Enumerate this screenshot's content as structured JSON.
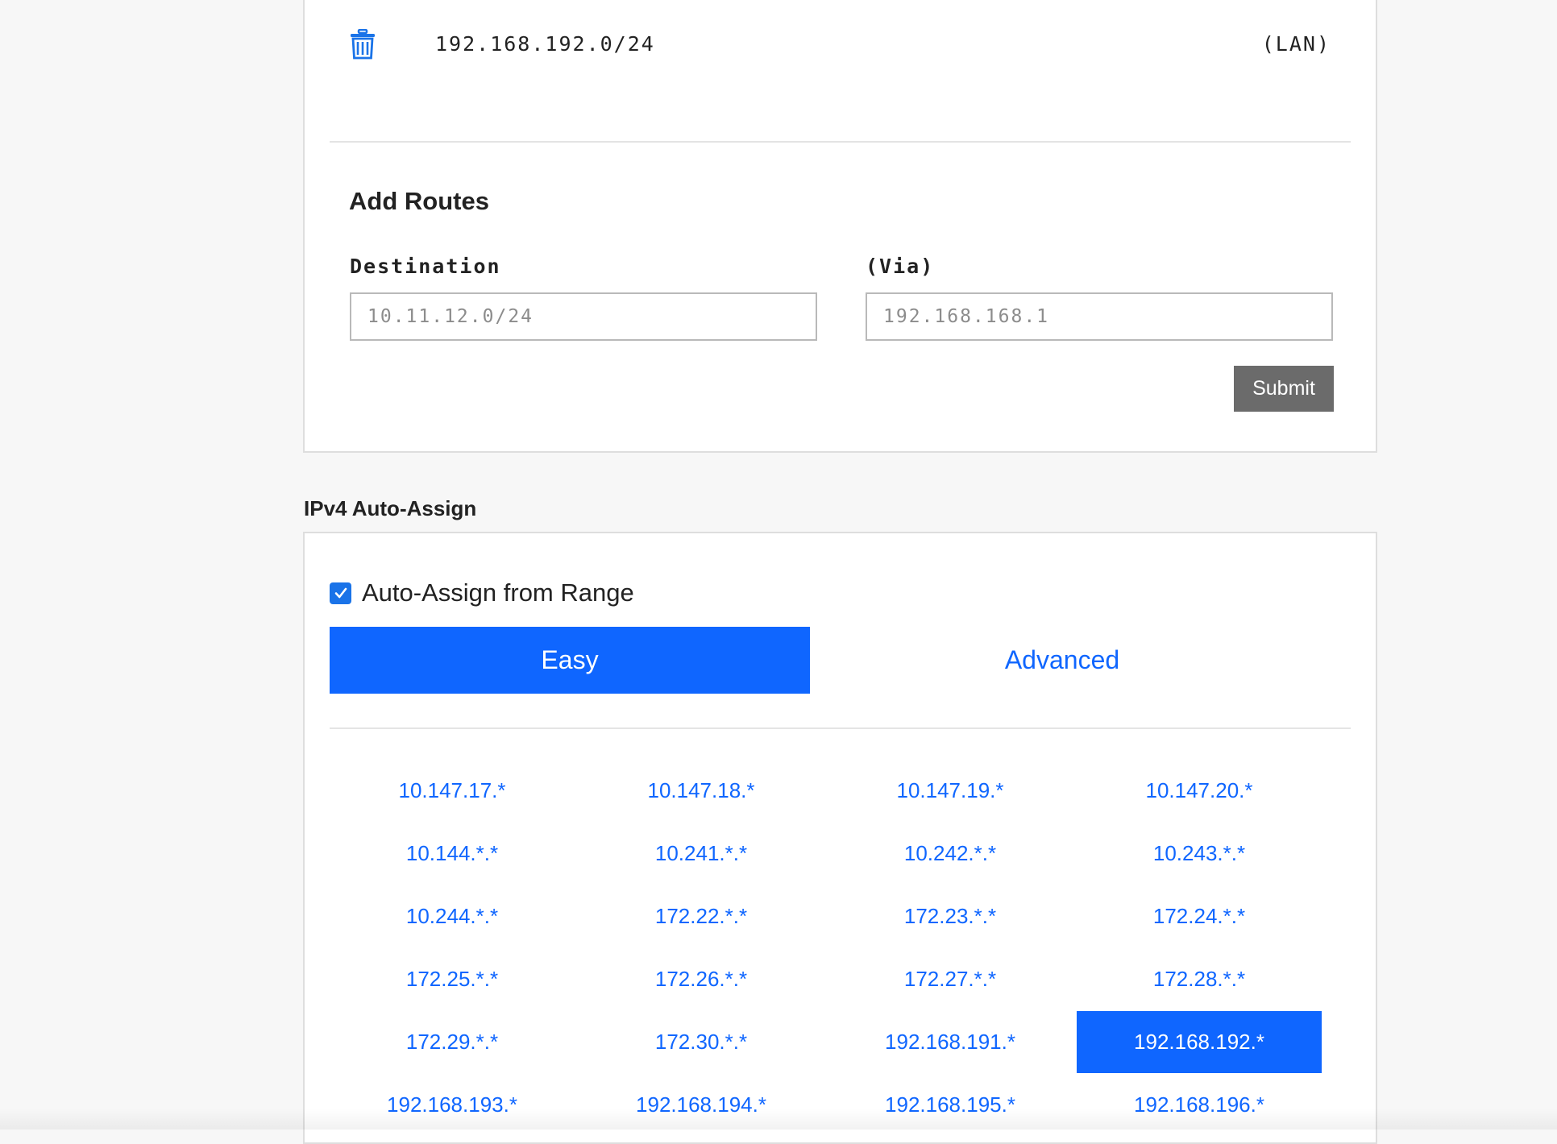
{
  "routes": {
    "existing": [
      {
        "destination": "192.168.192.0/24",
        "via": "(LAN)"
      }
    ],
    "add_heading": "Add Routes",
    "destination_label": "Destination",
    "destination_placeholder": "10.11.12.0/24",
    "via_label": "(Via)",
    "via_placeholder": "192.168.168.1",
    "submit_label": "Submit"
  },
  "auto_assign": {
    "section_title": "IPv4 Auto-Assign",
    "checkbox_label": "Auto-Assign from Range",
    "checkbox_checked": true,
    "tabs": [
      {
        "label": "Easy",
        "active": true
      },
      {
        "label": "Advanced",
        "active": false
      }
    ],
    "ranges": [
      "10.147.17.*",
      "10.147.18.*",
      "10.147.19.*",
      "10.147.20.*",
      "10.144.*.*",
      "10.241.*.*",
      "10.242.*.*",
      "10.243.*.*",
      "10.244.*.*",
      "172.22.*.*",
      "172.23.*.*",
      "172.24.*.*",
      "172.25.*.*",
      "172.26.*.*",
      "172.27.*.*",
      "172.28.*.*",
      "172.29.*.*",
      "172.30.*.*",
      "192.168.191.*",
      "192.168.192.*",
      "192.168.193.*",
      "192.168.194.*",
      "192.168.195.*",
      "192.168.196.*"
    ],
    "selected_range": "192.168.192.*"
  },
  "colors": {
    "accent": "#0f66ff",
    "submit_bg": "#6b6b6b",
    "trash_icon": "#1a73e8"
  }
}
